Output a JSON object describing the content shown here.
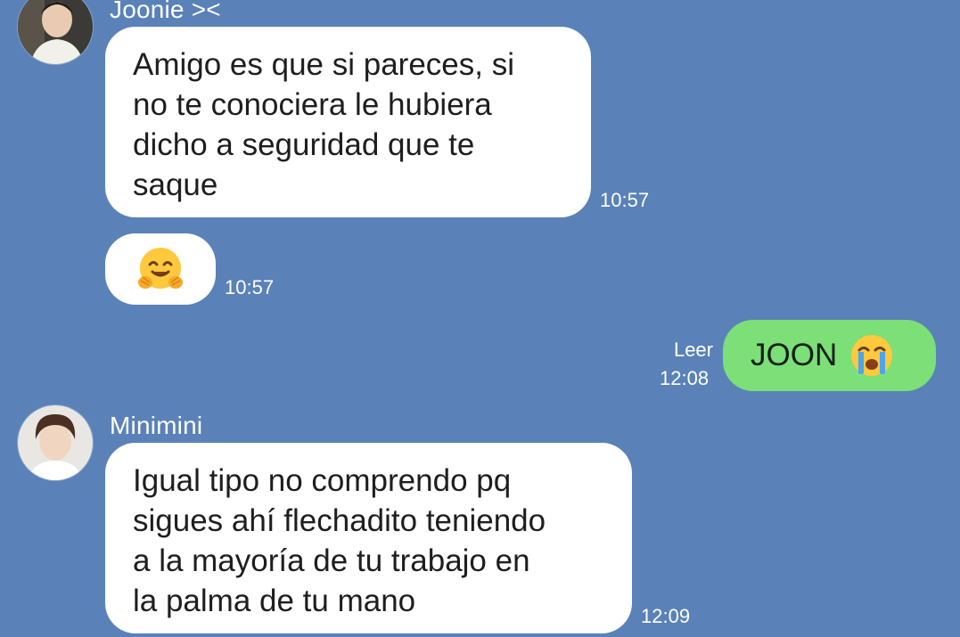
{
  "chat": {
    "messages": [
      {
        "sender": "Joonie ><",
        "text": "Amigo es que si pareces, si\nno te conociera le hubiera\ndicho a seguridad que te\nsaque",
        "time": "10:57",
        "direction": "incoming"
      },
      {
        "emoji": "hugging-face",
        "time": "10:57",
        "direction": "incoming"
      },
      {
        "text": "JOON",
        "emoji": "loudly-crying-face",
        "read_status": "Leer",
        "time": "12:08",
        "direction": "outgoing"
      },
      {
        "sender": "Minimini",
        "text": "Igual tipo no comprendo pq\nsigues ahí flechadito teniendo\na la mayoría de tu trabajo en\nla palma de tu mano",
        "time": "12:09",
        "direction": "incoming"
      }
    ]
  },
  "colors": {
    "background": "#5a82b8",
    "incoming_bubble": "#ffffff",
    "outgoing_bubble": "#7ddf78",
    "meta_text": "#ffffff"
  }
}
